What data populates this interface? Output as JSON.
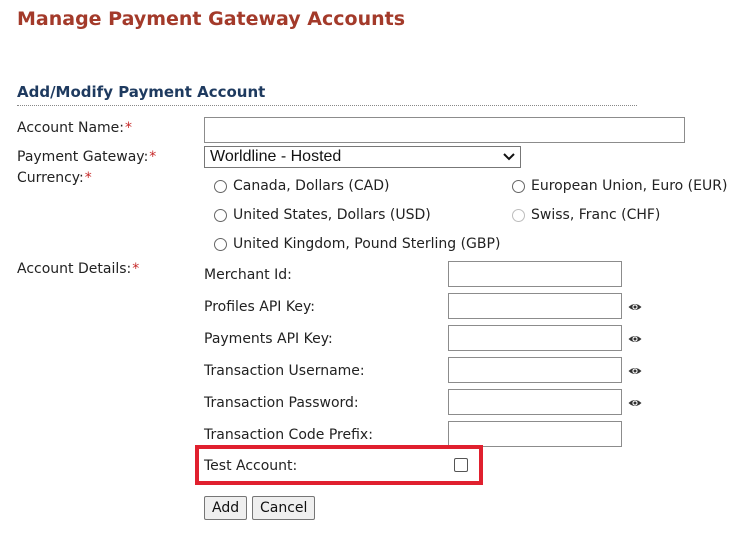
{
  "page": {
    "title": "Manage Payment Gateway Accounts"
  },
  "section": {
    "title": "Add/Modify Payment Account"
  },
  "form": {
    "account_name": {
      "label": "Account Name:",
      "required_mark": "*",
      "value": ""
    },
    "payment_gateway": {
      "label": "Payment Gateway:",
      "required_mark": "*",
      "selected": "Worldline - Hosted"
    },
    "currency": {
      "label": "Currency:",
      "required_mark": "*",
      "options": [
        {
          "label": "Canada, Dollars (CAD)",
          "selected": false,
          "disabled": false
        },
        {
          "label": "European Union, Euro (EUR)",
          "selected": false,
          "disabled": false
        },
        {
          "label": "United States, Dollars (USD)",
          "selected": false,
          "disabled": false
        },
        {
          "label": "Swiss, Franc (CHF)",
          "selected": false,
          "disabled": true
        },
        {
          "label": "United Kingdom, Pound Sterling (GBP)",
          "selected": false,
          "disabled": false
        }
      ]
    },
    "account_details": {
      "label": "Account Details:",
      "required_mark": "*",
      "fields": [
        {
          "label": "Merchant Id:",
          "value": "",
          "has_reveal_icon": false
        },
        {
          "label": "Profiles API Key:",
          "value": "",
          "has_reveal_icon": true
        },
        {
          "label": "Payments API Key:",
          "value": "",
          "has_reveal_icon": true
        },
        {
          "label": "Transaction Username:",
          "value": "",
          "has_reveal_icon": true
        },
        {
          "label": "Transaction Password:",
          "value": "",
          "has_reveal_icon": true
        },
        {
          "label": "Transaction Code Prefix:",
          "value": "",
          "has_reveal_icon": false
        }
      ],
      "test_account": {
        "label": "Test Account:",
        "checked": false
      }
    }
  },
  "buttons": {
    "add_label": "Add",
    "cancel_label": "Cancel"
  },
  "icons": {
    "reveal": "eye-icon",
    "dropdown": "chevron-down-icon"
  },
  "colors": {
    "title": "#a33a2a",
    "section_title": "#1e3a5f",
    "required": "#c62828",
    "highlight": "#e0202e"
  }
}
